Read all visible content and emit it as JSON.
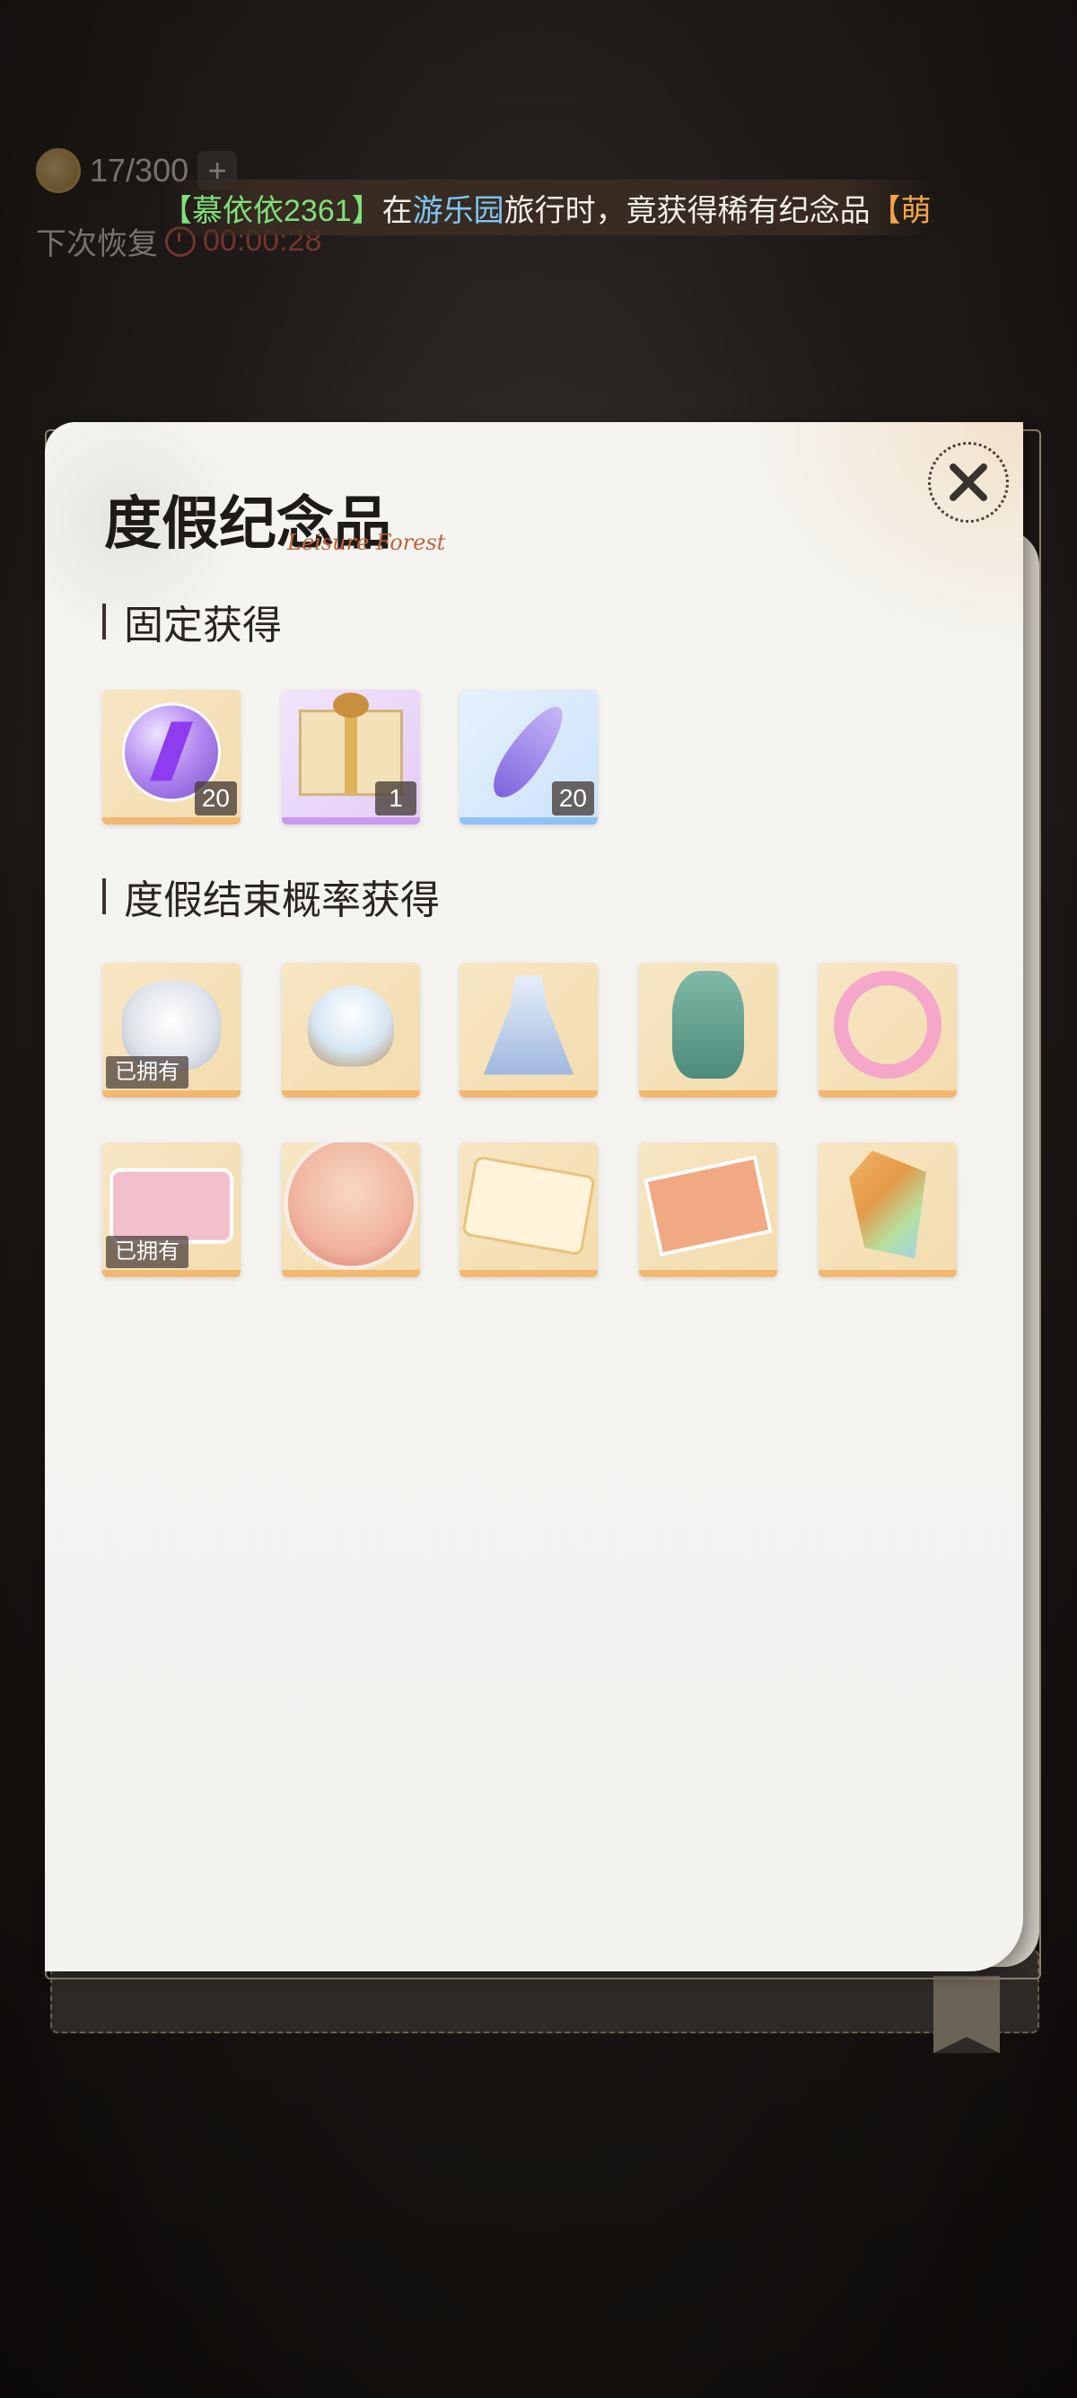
{
  "hud": {
    "energy": "17/300",
    "plus_label": "+",
    "recover_label": "下次恢复",
    "recover_time": "00:00:28"
  },
  "broadcast": {
    "player": "【慕依依2361】",
    "text1": "在",
    "place": "游乐园",
    "text2": "旅行时，竟获得稀有纪念品",
    "item": "【萌芽"
  },
  "panel": {
    "title": "度假纪念品",
    "title_script": "Leisure Forest"
  },
  "sections": {
    "fixed": {
      "title": "固定获得"
    },
    "chance": {
      "title": "度假结束概率获得"
    }
  },
  "fixed_items": [
    {
      "icon": "energy-orb-icon",
      "count": "20"
    },
    {
      "icon": "gift-box-icon",
      "count": "1"
    },
    {
      "icon": "feather-icon",
      "count": "20"
    }
  ],
  "chance_items": [
    {
      "icon": "chibi-bath-icon",
      "owned": "已拥有"
    },
    {
      "icon": "flower-basket-icon"
    },
    {
      "icon": "dress-icon"
    },
    {
      "icon": "portrait-icon"
    },
    {
      "icon": "flower-wreath-icon"
    },
    {
      "icon": "pink-frame-icon",
      "owned": "已拥有"
    },
    {
      "icon": "avatar-icon"
    },
    {
      "icon": "cat-card-icon"
    },
    {
      "icon": "photo-card-icon"
    },
    {
      "icon": "crystal-icon"
    }
  ],
  "colors": {
    "player": "#7fe07a",
    "place": "#7cc8f2",
    "item": "#f2a64a",
    "recover_time": "#e0574a"
  }
}
